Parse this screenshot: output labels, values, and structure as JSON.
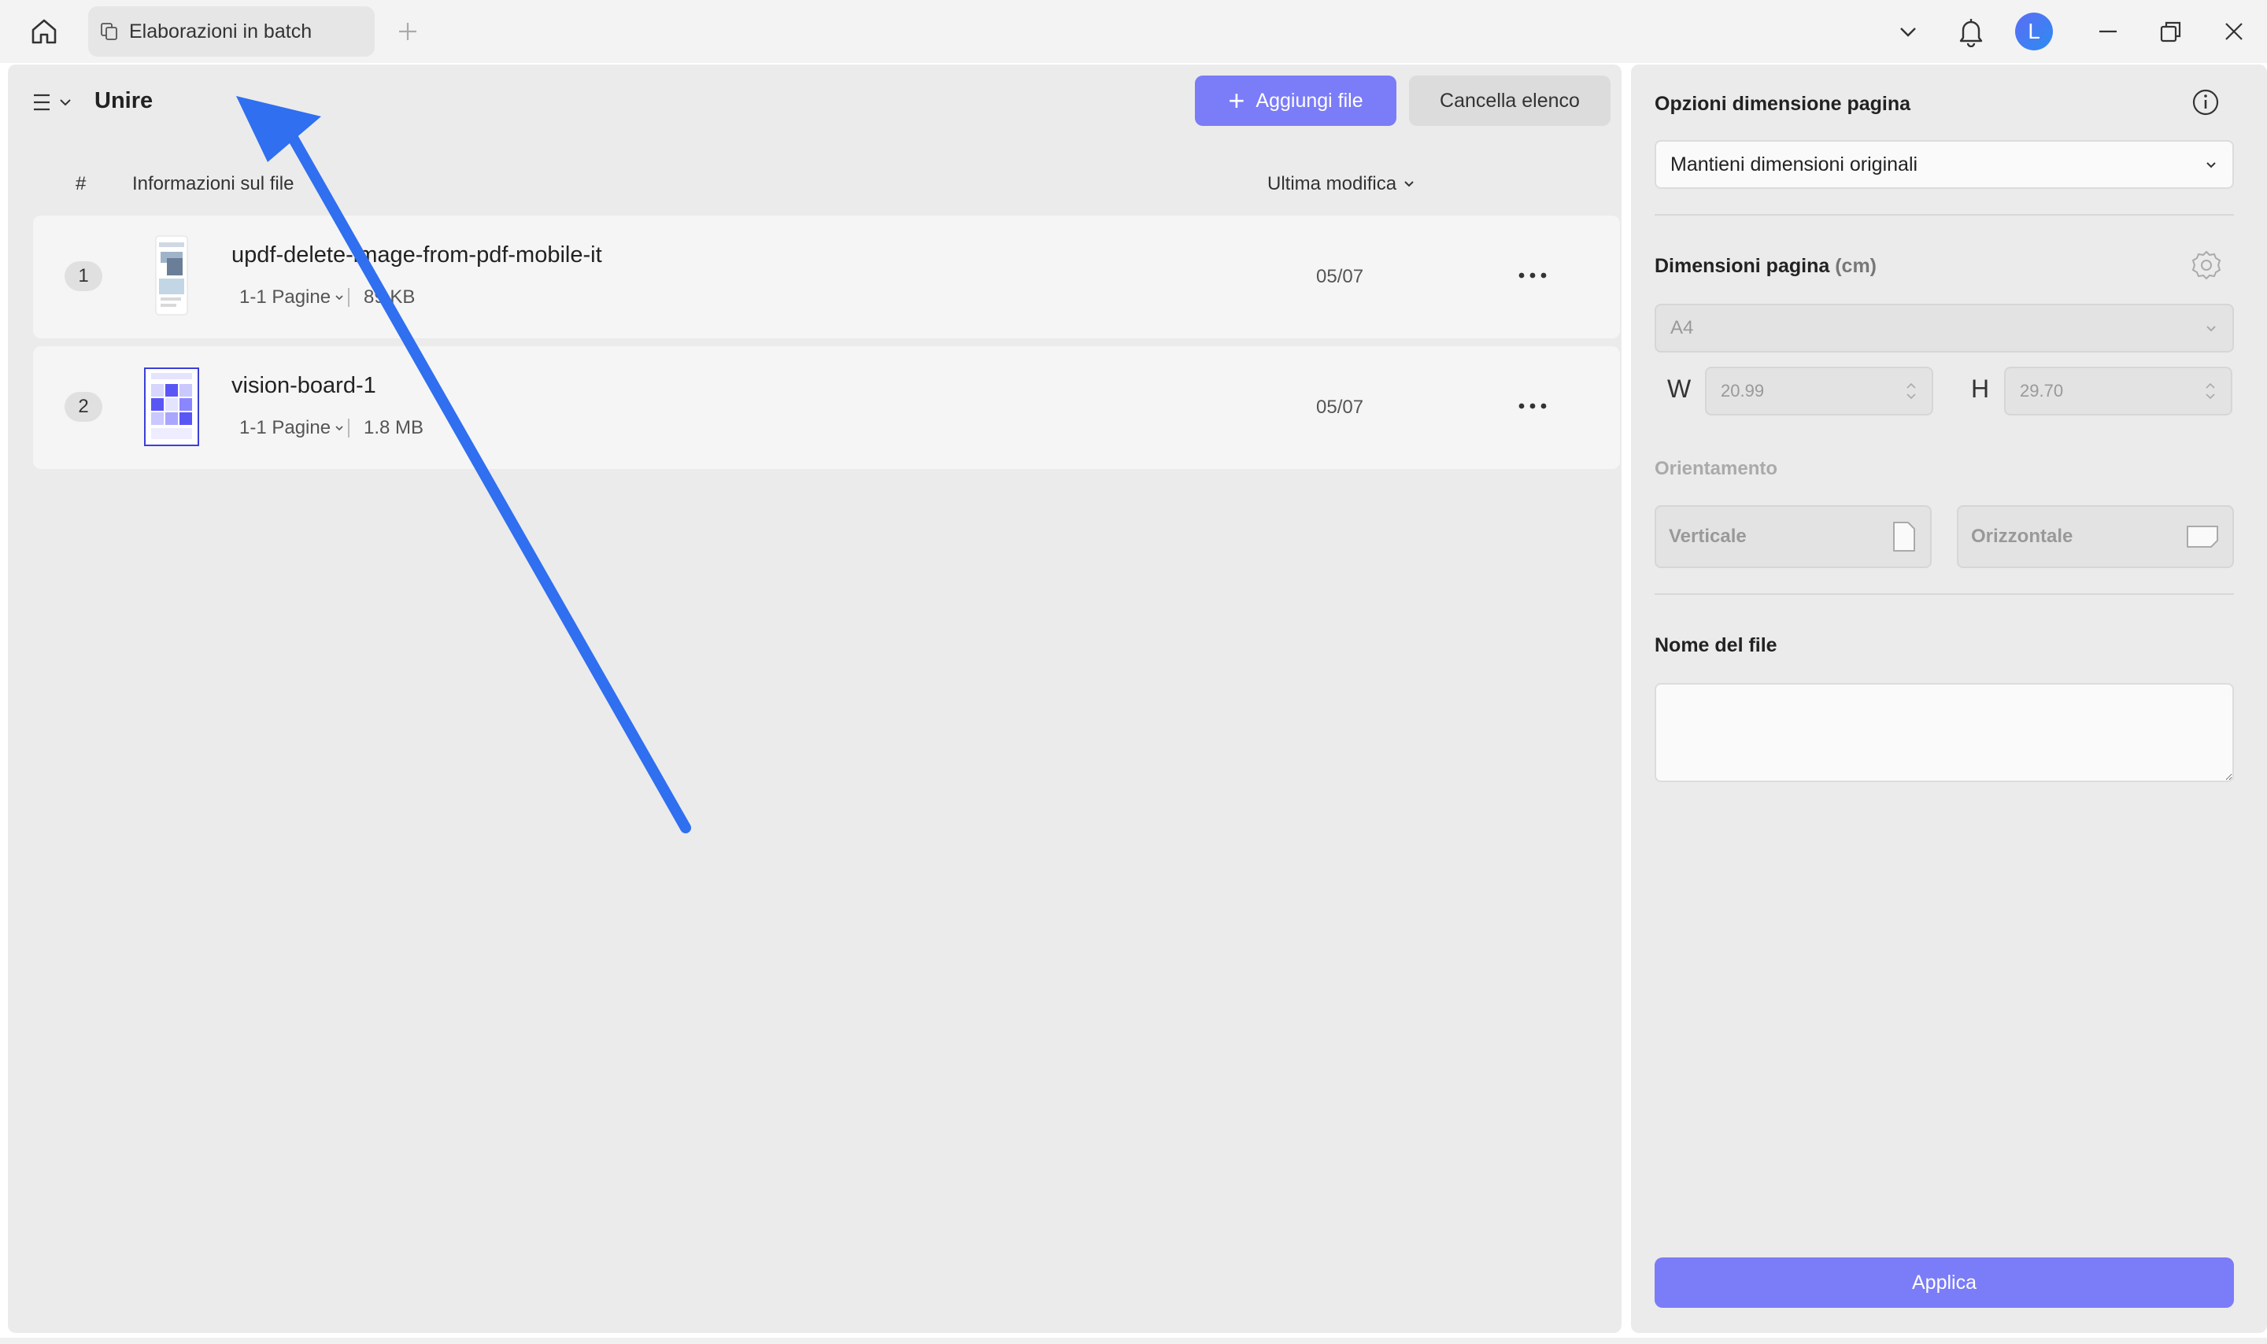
{
  "titlebar": {
    "tab_label": "Elaborazioni in batch",
    "avatar_letter": "L"
  },
  "main": {
    "menu_icon": "hamburger-menu-icon",
    "title": "Unire",
    "add_button": "Aggiungi file",
    "clear_button": "Cancella elenco",
    "columns": {
      "index": "#",
      "info": "Informazioni sul file",
      "modified": "Ultima modifica"
    },
    "files": [
      {
        "index": "1",
        "name": "updf-delete-image-from-pdf-mobile-it",
        "pages": "1-1 Pagine",
        "size": "89 KB",
        "date": "05/07"
      },
      {
        "index": "2",
        "name": "vision-board-1",
        "pages": "1-1 Pagine",
        "size": "1.8 MB",
        "date": "05/07"
      }
    ]
  },
  "sidebar": {
    "page_size_options_title": "Opzioni dimensione pagina",
    "page_size_option_value": "Mantieni dimensioni originali",
    "page_dimensions_title": "Dimensioni pagina",
    "page_dimensions_unit": "(cm)",
    "paper_size": "A4",
    "width_label": "W",
    "width_value": "20.99",
    "height_label": "H",
    "height_value": "29.70",
    "orientation_title": "Orientamento",
    "orientation_portrait": "Verticale",
    "orientation_landscape": "Orizzontale",
    "filename_title": "Nome del file",
    "filename_value": "",
    "apply_button": "Applica"
  },
  "colors": {
    "accent": "#7b7cf7",
    "annotation_arrow": "#2f6ff0"
  }
}
